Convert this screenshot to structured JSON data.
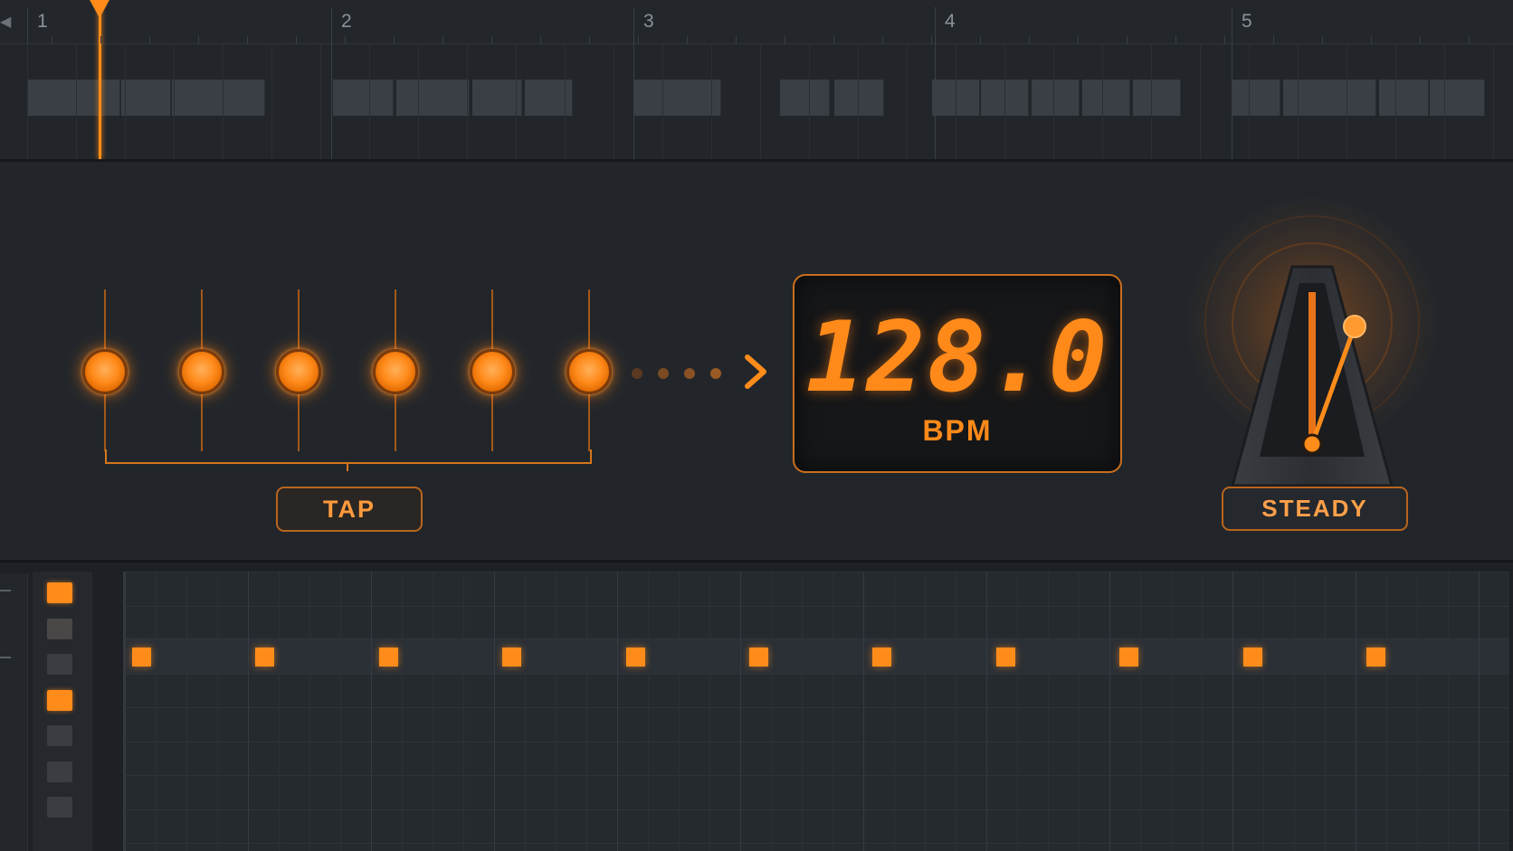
{
  "timeline": {
    "bars": [
      "1",
      "2",
      "3",
      "4",
      "5"
    ],
    "playhead_label": ""
  },
  "tap_section": {
    "button_label": "TAP",
    "tap_count": 6
  },
  "tempo_display": {
    "value": "128.0",
    "unit": "BPM"
  },
  "metronome": {
    "status_label": "STEADY"
  },
  "sequencer": {
    "row_pads_active": [
      true,
      false,
      false,
      true,
      false,
      false,
      false
    ],
    "active_step_count": 11
  },
  "colors": {
    "accent": "#ff8c1a",
    "background": "#22262b",
    "display_bg": "#161719"
  },
  "icons": {
    "playhead": "playhead-marker-icon",
    "arrow": "chevron-right-icon",
    "metronome": "metronome-icon"
  }
}
